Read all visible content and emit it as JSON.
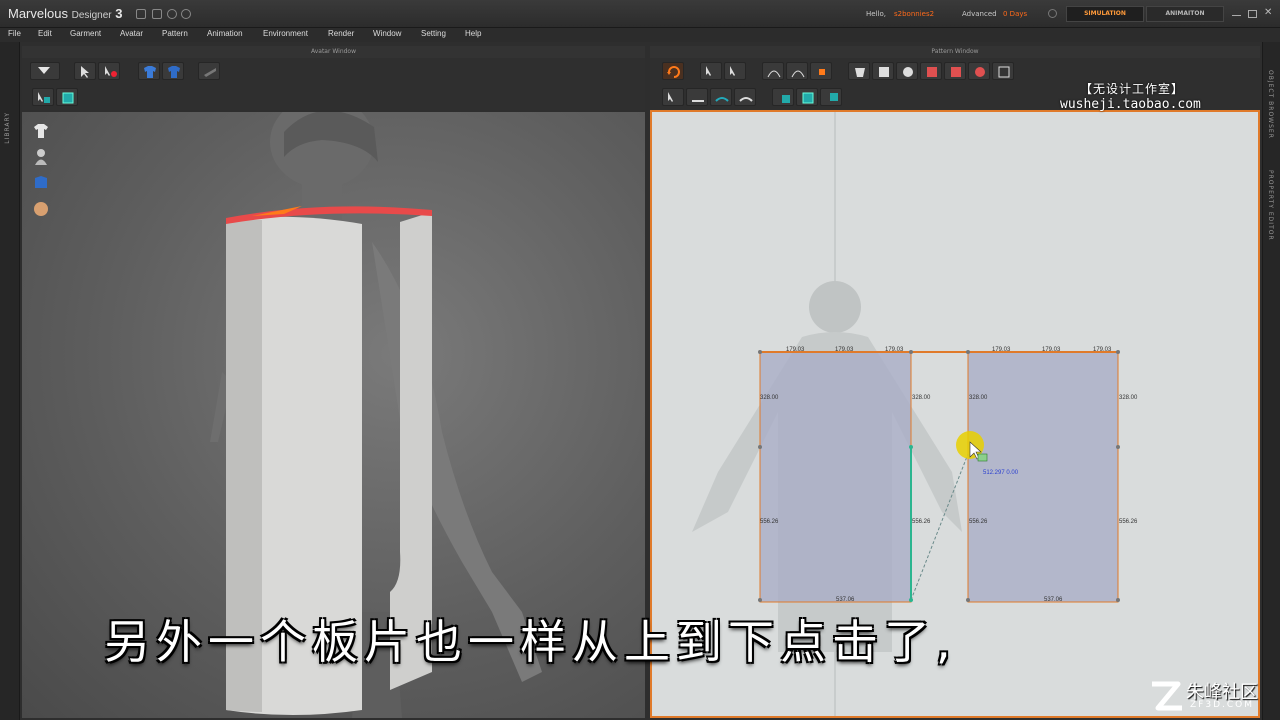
{
  "app": {
    "logo_main": "Marvelous",
    "logo_sub": "Designer",
    "logo_version": "3",
    "hello": "Hello,",
    "username": "s2bonnies2",
    "license": "Advanced",
    "days": "0 Days",
    "mode_simulation": "SIMULATION",
    "mode_animation": "ANIMAITON"
  },
  "menu": [
    "File",
    "Edit",
    "Garment",
    "Avatar",
    "Pattern",
    "Animation",
    "Environment",
    "Render",
    "Window",
    "Setting",
    "Help"
  ],
  "panels": {
    "avatar_window": "Avatar Window",
    "pattern_window": "Pattern Window",
    "library": "LIBRARY",
    "object_browser": "OBJECT BROWSER",
    "property_editor": "PROPERTY EDITOR"
  },
  "pattern_dims": {
    "top": [
      "179.03",
      "179.03",
      "179.03",
      "179.03",
      "179.03",
      "179.03"
    ],
    "side_upper": [
      "328.00",
      "328.00",
      "328.00",
      "328.00"
    ],
    "side_lower": [
      "556.26",
      "556.26",
      "556.26",
      "556.26"
    ],
    "bottom": [
      "537.06",
      "537.06"
    ],
    "cursor_readout": "512.297 0.00"
  },
  "watermark": {
    "title": "【无设计工作室】",
    "url": "wusheji.taobao.com"
  },
  "subtitle": "另外一个板片也一样从上到下点击了,",
  "corner": {
    "name": "朱峰社区",
    "site": "ZF3D.COM"
  },
  "colors": {
    "accent": "#ff6a1a",
    "pattern_fill": "#a8adc7",
    "pattern_border": "#e07a2a"
  }
}
